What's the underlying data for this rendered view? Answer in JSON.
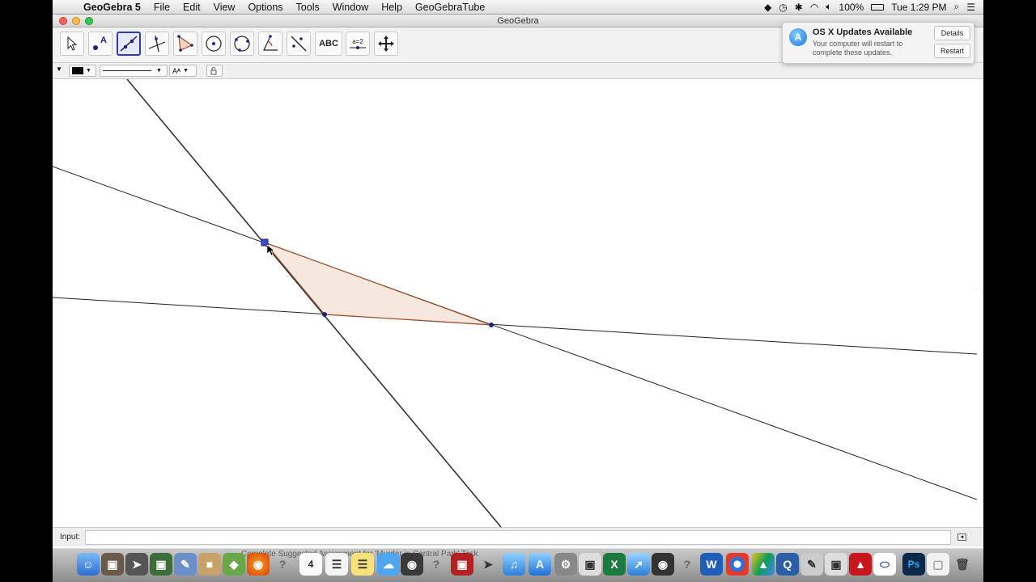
{
  "menubar": {
    "app_name": "GeoGebra 5",
    "items": [
      "File",
      "Edit",
      "View",
      "Options",
      "Tools",
      "Window",
      "Help",
      "GeoGebraTube"
    ],
    "battery": "100%",
    "clock": "Tue 1:29 PM"
  },
  "window": {
    "title": "GeoGebra"
  },
  "toolbar": {
    "text_tool_label": "ABC",
    "slider_tool_label": "a=2",
    "tools": [
      "move-tool-icon",
      "point-tool-icon",
      "line-tool-icon",
      "perpendicular-line-tool-icon",
      "polygon-tool-icon",
      "circle-tool-icon",
      "circle-three-points-tool-icon",
      "angle-tool-icon",
      "reflect-tool-icon",
      "text-tool-icon",
      "slider-tool-icon",
      "move-graphics-view-tool-icon"
    ]
  },
  "stylebar": {
    "color_swatch": "#000000",
    "text_size_label": "Aᴬ"
  },
  "input_bar": {
    "label": "Input:",
    "value": "",
    "placeholder": ""
  },
  "notification": {
    "title": "OS X Updates Available",
    "body": "Your computer will restart to complete these updates.",
    "details_button": "Details",
    "restart_button": "Restart"
  },
  "dock": {
    "tooltip": "Complete Suggested Assignment for 'Murder in Central Park' Task",
    "calendar_day": "4"
  },
  "colors": {
    "polygon_fill": "#f5e4db",
    "polygon_edge": "#9a4b28",
    "point": "#1a237e",
    "selection": "#2c3bb0"
  }
}
